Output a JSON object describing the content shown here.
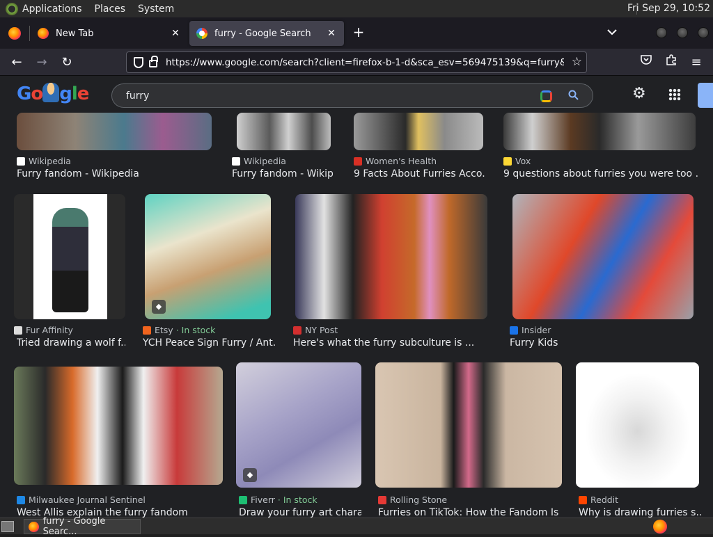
{
  "system_bar": {
    "menus": [
      "Applications",
      "Places",
      "System"
    ],
    "clock": "Fri Sep 29, 10:52"
  },
  "tabs": [
    {
      "title": "New Tab",
      "icon": "firefox-icon",
      "active": false
    },
    {
      "title": "furry - Google Search",
      "icon": "google-icon",
      "active": true
    }
  ],
  "tab_controls": {
    "close_glyph": "✕",
    "new_tab_glyph": "+",
    "list_all_tabs_glyph": "⌵"
  },
  "nav": {
    "back_glyph": "←",
    "forward_glyph": "→",
    "reload_glyph": "↻",
    "url": "https://www.google.com/search?client=firefox-b-1-d&sca_esv=569475139&q=furry&tbm=isch",
    "bookmark_glyph": "☆",
    "menu_glyph": "≡"
  },
  "google": {
    "search_value": "furry",
    "search_glyph": "🔍",
    "settings_glyph": "⚙",
    "logo_colors": [
      "#4285f4",
      "#ea4335",
      "#fbbc05",
      "#4285f4",
      "#34a853",
      "#ea4335"
    ]
  },
  "results": {
    "row1": [
      {
        "source": "Wikipedia",
        "title": "Furry fandom - Wikipedia",
        "favicon": "wikipedia-icon",
        "fav_color": "#ffffff"
      },
      {
        "source": "Wikipedia",
        "title": "Furry fandom - Wikip...",
        "favicon": "wikipedia-icon",
        "fav_color": "#ffffff"
      },
      {
        "source": "Women's Health",
        "title": "9 Facts About Furries Acco...",
        "favicon": "womens-health-icon",
        "fav_color": "#d93025"
      },
      {
        "source": "Vox",
        "title": "9 questions about furries you were too ...",
        "favicon": "vox-icon",
        "fav_color": "#fdd835"
      }
    ],
    "row2": [
      {
        "source": "Fur Affinity",
        "title": "Tried drawing a wolf f...",
        "favicon": "fur-affinity-icon",
        "fav_color": "#dddddd",
        "stock": ""
      },
      {
        "source": "Etsy",
        "title": "YCH Peace Sign Furry / Ant...",
        "favicon": "etsy-icon",
        "fav_color": "#f1641e",
        "stock": "· In stock"
      },
      {
        "source": "NY Post",
        "title": "Here's what the furry subculture is ...",
        "favicon": "ny-post-icon",
        "fav_color": "#d32f2f",
        "stock": ""
      },
      {
        "source": "Insider",
        "title": "Furry Kids",
        "favicon": "insider-icon",
        "fav_color": "#1a73e8",
        "stock": ""
      }
    ],
    "row3": [
      {
        "source": "Milwaukee Journal Sentinel",
        "title": "West Allis explain the furry fandom",
        "favicon": "milwaukee-journal-icon",
        "fav_color": "#1e88e5",
        "stock": ""
      },
      {
        "source": "Fiverr",
        "title": "Draw your furry art chara...",
        "favicon": "fiverr-icon",
        "fav_color": "#1dbf73",
        "stock": "· In stock"
      },
      {
        "source": "Rolling Stone",
        "title": "Furries on TikTok: How the Fandom Is ...",
        "favicon": "rolling-stone-icon",
        "fav_color": "#e53935",
        "stock": ""
      },
      {
        "source": "Reddit",
        "title": "Why is drawing furries s...",
        "favicon": "reddit-icon",
        "fav_color": "#ff4500",
        "stock": ""
      }
    ]
  },
  "taskbar": {
    "task_label": "furry - Google Searc..."
  }
}
